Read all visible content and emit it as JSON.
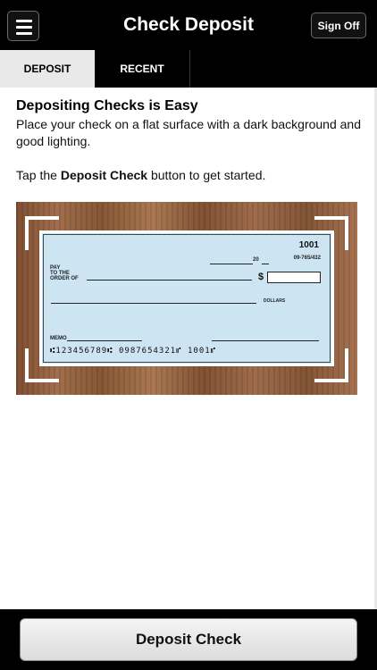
{
  "header": {
    "title": "Check Deposit",
    "sign_off_label": "Sign Off"
  },
  "tabs": [
    {
      "label": "DEPOSIT",
      "active": true
    },
    {
      "label": "RECENT",
      "active": false
    }
  ],
  "content": {
    "heading": "Depositing Checks is Easy",
    "description": "Place your check on a flat surface with a dark background and good lighting.",
    "tap_prefix": "Tap the ",
    "tap_bold": "Deposit Check",
    "tap_suffix": " button to get started."
  },
  "check": {
    "number": "1001",
    "routing_small": "09-765/432",
    "date_prefix": "20",
    "pay_label_line1": "PAY",
    "pay_label_line2": "TO THE",
    "pay_label_line3": "ORDER OF",
    "dollar_sign": "$",
    "dollars_label": "DOLLARS",
    "memo_label": "MEMO",
    "micr": "⑆123456789⑆ 0987654321⑈ 1001⑈"
  },
  "footer": {
    "deposit_button_label": "Deposit Check"
  },
  "colors": {
    "header_bg": "#000000",
    "active_tab_bg": "#e9e9e9",
    "check_bg": "#cde4f3"
  }
}
